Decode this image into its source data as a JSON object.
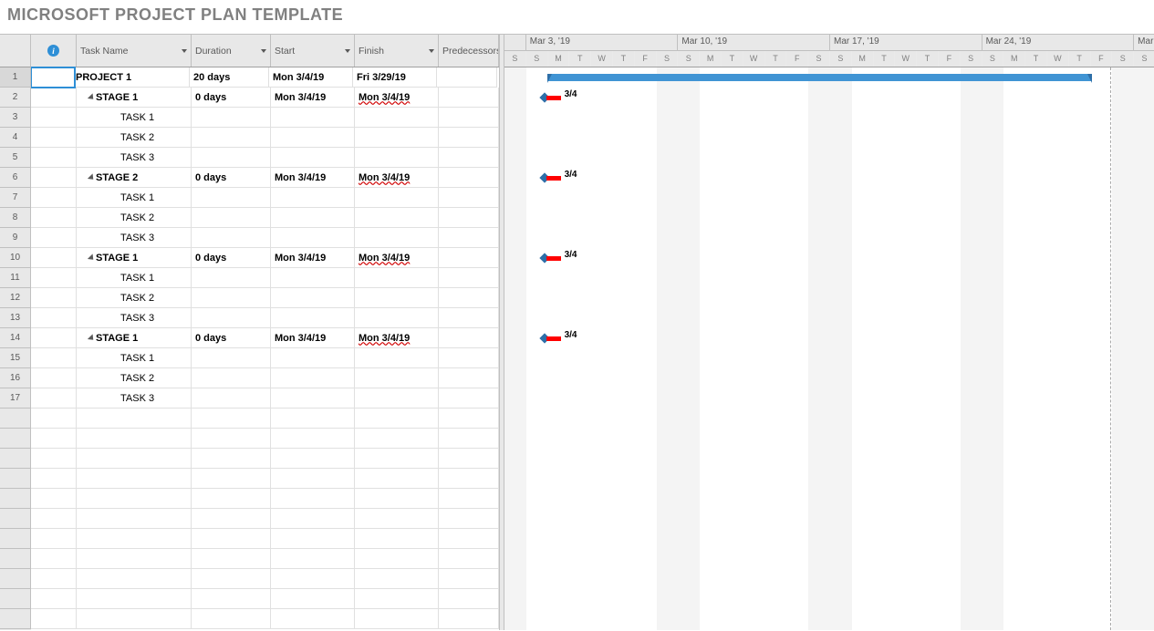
{
  "title": "MICROSOFT PROJECT PLAN TEMPLATE",
  "columns": {
    "task_name": "Task Name",
    "duration": "Duration",
    "start": "Start",
    "finish": "Finish",
    "predecessors": "Predecessors"
  },
  "rows": [
    {
      "num": "1",
      "name": "PROJECT 1",
      "duration": "20 days",
      "start": "Mon 3/4/19",
      "finish": "Fri 3/29/19",
      "level": 0,
      "bold": true,
      "outline": true,
      "squigglyFinish": false,
      "barType": "summary",
      "barStart": 1,
      "barEnd": 26,
      "msLabel": "",
      "selected": true
    },
    {
      "num": "2",
      "name": "STAGE 1",
      "duration": "0 days",
      "start": "Mon 3/4/19",
      "finish": "Mon 3/4/19",
      "level": 1,
      "bold": true,
      "outline": true,
      "squigglyFinish": true,
      "barType": "milestone",
      "barStart": 1,
      "msLabel": "3/4"
    },
    {
      "num": "3",
      "name": "TASK 1",
      "duration": "",
      "start": "",
      "finish": "",
      "level": 2,
      "bold": false,
      "outline": false,
      "squigglyFinish": false,
      "barType": "none"
    },
    {
      "num": "4",
      "name": "TASK 2",
      "duration": "",
      "start": "",
      "finish": "",
      "level": 2,
      "bold": false,
      "outline": false,
      "squigglyFinish": false,
      "barType": "none"
    },
    {
      "num": "5",
      "name": "TASK 3",
      "duration": "",
      "start": "",
      "finish": "",
      "level": 2,
      "bold": false,
      "outline": false,
      "squigglyFinish": false,
      "barType": "none"
    },
    {
      "num": "6",
      "name": "STAGE 2",
      "duration": "0 days",
      "start": "Mon 3/4/19",
      "finish": "Mon 3/4/19",
      "level": 1,
      "bold": true,
      "outline": true,
      "squigglyFinish": true,
      "barType": "milestone",
      "barStart": 1,
      "msLabel": "3/4"
    },
    {
      "num": "7",
      "name": "TASK 1",
      "duration": "",
      "start": "",
      "finish": "",
      "level": 2,
      "bold": false,
      "outline": false,
      "squigglyFinish": false,
      "barType": "none"
    },
    {
      "num": "8",
      "name": "TASK 2",
      "duration": "",
      "start": "",
      "finish": "",
      "level": 2,
      "bold": false,
      "outline": false,
      "squigglyFinish": false,
      "barType": "none"
    },
    {
      "num": "9",
      "name": "TASK 3",
      "duration": "",
      "start": "",
      "finish": "",
      "level": 2,
      "bold": false,
      "outline": false,
      "squigglyFinish": false,
      "barType": "none"
    },
    {
      "num": "10",
      "name": "STAGE 1",
      "duration": "0 days",
      "start": "Mon 3/4/19",
      "finish": "Mon 3/4/19",
      "level": 1,
      "bold": true,
      "outline": true,
      "squigglyFinish": true,
      "barType": "milestone",
      "barStart": 1,
      "msLabel": "3/4"
    },
    {
      "num": "11",
      "name": "TASK 1",
      "duration": "",
      "start": "",
      "finish": "",
      "level": 2,
      "bold": false,
      "outline": false,
      "squigglyFinish": false,
      "barType": "none"
    },
    {
      "num": "12",
      "name": "TASK 2",
      "duration": "",
      "start": "",
      "finish": "",
      "level": 2,
      "bold": false,
      "outline": false,
      "squigglyFinish": false,
      "barType": "none"
    },
    {
      "num": "13",
      "name": "TASK 3",
      "duration": "",
      "start": "",
      "finish": "",
      "level": 2,
      "bold": false,
      "outline": false,
      "squigglyFinish": false,
      "barType": "none"
    },
    {
      "num": "14",
      "name": "STAGE 1",
      "duration": "0 days",
      "start": "Mon 3/4/19",
      "finish": "Mon 3/4/19",
      "level": 1,
      "bold": true,
      "outline": true,
      "squigglyFinish": true,
      "barType": "milestone",
      "barStart": 1,
      "msLabel": "3/4"
    },
    {
      "num": "15",
      "name": "TASK 1",
      "duration": "",
      "start": "",
      "finish": "",
      "level": 2,
      "bold": false,
      "outline": false,
      "squigglyFinish": false,
      "barType": "none"
    },
    {
      "num": "16",
      "name": "TASK 2",
      "duration": "",
      "start": "",
      "finish": "",
      "level": 2,
      "bold": false,
      "outline": false,
      "squigglyFinish": false,
      "barType": "none"
    },
    {
      "num": "17",
      "name": "TASK 3",
      "duration": "",
      "start": "",
      "finish": "",
      "level": 2,
      "bold": false,
      "outline": false,
      "squigglyFinish": false,
      "barType": "none"
    }
  ],
  "empty_rows": 11,
  "timeline": {
    "day_width": 23.8,
    "weeks": [
      {
        "label": "",
        "days": 1
      },
      {
        "label": "Mar 3, '19",
        "days": 7
      },
      {
        "label": "Mar 10, '19",
        "days": 7
      },
      {
        "label": "Mar 17, '19",
        "days": 7
      },
      {
        "label": "Mar 24, '19",
        "days": 7
      },
      {
        "label": "Mar",
        "days": 1
      }
    ],
    "day_letters": [
      "S",
      "S",
      "M",
      "T",
      "W",
      "T",
      "F",
      "S",
      "S",
      "M",
      "T",
      "W",
      "T",
      "F",
      "S",
      "S",
      "M",
      "T",
      "W",
      "T",
      "F",
      "S",
      "S",
      "M",
      "T",
      "W",
      "T",
      "F",
      "S",
      "S"
    ],
    "weekend_positions": [
      0,
      7,
      14,
      21,
      28
    ],
    "weekend_first_width": 1,
    "today_offset": 27.9
  }
}
